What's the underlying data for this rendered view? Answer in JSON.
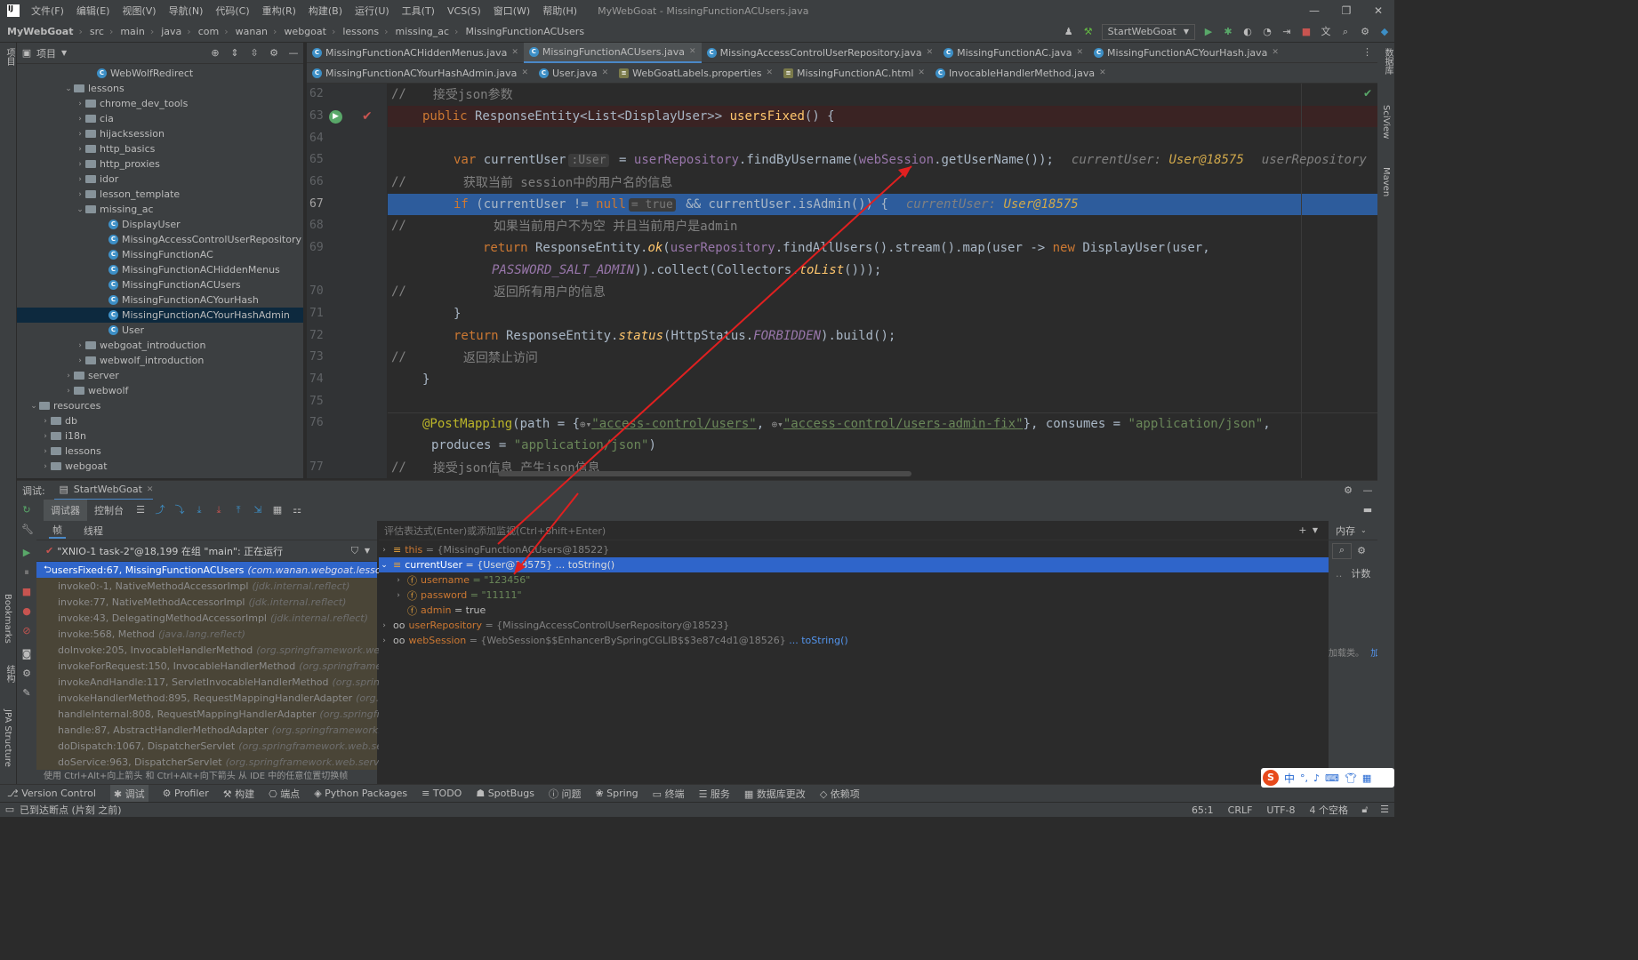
{
  "menu": [
    "文件(F)",
    "编辑(E)",
    "视图(V)",
    "导航(N)",
    "代码(C)",
    "重构(R)",
    "构建(B)",
    "运行(U)",
    "工具(T)",
    "VCS(S)",
    "窗口(W)",
    "帮助(H)"
  ],
  "window_title": "MyWebGoat - MissingFunctionACUsers.java",
  "breadcrumbs": [
    "MyWebGoat",
    "src",
    "main",
    "java",
    "com",
    "wanan",
    "webgoat",
    "lessons",
    "missing_ac",
    "MissingFunctionACUsers"
  ],
  "run_config": "StartWebGoat",
  "project_label": "项目",
  "tree": [
    {
      "label": "WebWolfRedirect",
      "type": "class",
      "depth": 6,
      "arrow": ""
    },
    {
      "label": "lessons",
      "type": "folder",
      "depth": 4,
      "arrow": "open"
    },
    {
      "label": "chrome_dev_tools",
      "type": "folder",
      "depth": 5,
      "arrow": "closed"
    },
    {
      "label": "cia",
      "type": "folder",
      "depth": 5,
      "arrow": "closed"
    },
    {
      "label": "hijacksession",
      "type": "folder",
      "depth": 5,
      "arrow": "closed"
    },
    {
      "label": "http_basics",
      "type": "folder",
      "depth": 5,
      "arrow": "closed"
    },
    {
      "label": "http_proxies",
      "type": "folder",
      "depth": 5,
      "arrow": "closed"
    },
    {
      "label": "idor",
      "type": "folder",
      "depth": 5,
      "arrow": "closed"
    },
    {
      "label": "lesson_template",
      "type": "folder",
      "depth": 5,
      "arrow": "closed"
    },
    {
      "label": "missing_ac",
      "type": "folder",
      "depth": 5,
      "arrow": "open"
    },
    {
      "label": "DisplayUser",
      "type": "class",
      "depth": 7,
      "arrow": ""
    },
    {
      "label": "MissingAccessControlUserRepository",
      "type": "class",
      "depth": 7,
      "arrow": ""
    },
    {
      "label": "MissingFunctionAC",
      "type": "class",
      "depth": 7,
      "arrow": ""
    },
    {
      "label": "MissingFunctionACHiddenMenus",
      "type": "class",
      "depth": 7,
      "arrow": ""
    },
    {
      "label": "MissingFunctionACUsers",
      "type": "class",
      "depth": 7,
      "arrow": ""
    },
    {
      "label": "MissingFunctionACYourHash",
      "type": "class",
      "depth": 7,
      "arrow": ""
    },
    {
      "label": "MissingFunctionACYourHashAdmin",
      "type": "class",
      "depth": 7,
      "arrow": "",
      "selected": true
    },
    {
      "label": "User",
      "type": "class",
      "depth": 7,
      "arrow": ""
    },
    {
      "label": "webgoat_introduction",
      "type": "folder",
      "depth": 5,
      "arrow": "closed"
    },
    {
      "label": "webwolf_introduction",
      "type": "folder",
      "depth": 5,
      "arrow": "closed"
    },
    {
      "label": "server",
      "type": "folder",
      "depth": 4,
      "arrow": "closed"
    },
    {
      "label": "webwolf",
      "type": "folder",
      "depth": 4,
      "arrow": "closed"
    },
    {
      "label": "resources",
      "type": "folder",
      "depth": 1,
      "arrow": "open"
    },
    {
      "label": "db",
      "type": "folder",
      "depth": 2,
      "arrow": "closed"
    },
    {
      "label": "i18n",
      "type": "folder",
      "depth": 2,
      "arrow": "closed"
    },
    {
      "label": "lessons",
      "type": "folder",
      "depth": 2,
      "arrow": "closed"
    },
    {
      "label": "webgoat",
      "type": "folder",
      "depth": 2,
      "arrow": "closed"
    }
  ],
  "tabs_row1": [
    {
      "label": "MissingFunctionACHiddenMenus.java",
      "active": false
    },
    {
      "label": "MissingFunctionACUsers.java",
      "active": true
    },
    {
      "label": "MissingAccessControlUserRepository.java",
      "active": false
    },
    {
      "label": "MissingFunctionAC.java",
      "active": false
    },
    {
      "label": "MissingFunctionACYourHash.java",
      "active": false
    }
  ],
  "tabs_row2": [
    {
      "label": "MissingFunctionACYourHashAdmin.java",
      "active": false
    },
    {
      "label": "User.java",
      "active": false
    },
    {
      "label": "WebGoatLabels.properties",
      "active": false
    },
    {
      "label": "MissingFunctionAC.html",
      "active": false
    },
    {
      "label": "InvocableHandlerMethod.java",
      "active": false
    }
  ],
  "line_numbers": [
    "62",
    "63",
    "64",
    "65",
    "66",
    "67",
    "68",
    "69",
    "",
    "70",
    "71",
    "72",
    "73",
    "74",
    "75",
    "76",
    "",
    "77"
  ],
  "code": {
    "l62": "接受json参数",
    "l63_kw": "public",
    "l63_type": " ResponseEntity<List<DisplayUser>> ",
    "l63_fn": "usersFixed",
    "l63_end": "() {",
    "l65_var": "var",
    "l65_name": " currentUser",
    "l65_hint": ":User",
    "l65_eq": " = ",
    "l65_repo": "userRepository",
    "l65_call": ".findByUsername(",
    "l65_sess": "webSession",
    "l65_end": ".getUserName());",
    "l65_inl_label": "currentUser: ",
    "l65_inl_val": "User@18575",
    "l65_inl2": "userRepository",
    "l66": "获取当前 session中的用户名的信息",
    "l67_if": "if",
    "l67_a": " (currentUser != ",
    "l67_null": "null",
    "l67_hint": "= true",
    "l67_b": " && currentUser.isAdmin()) {",
    "l67_inl_label": "currentUser: ",
    "l67_inl_val": "User@18575",
    "l68": "如果当前用户不为空 并且当前用户是admin",
    "l69_ret": "return",
    "l69_a": " ResponseEntity.",
    "l69_ok": "ok",
    "l69_b": "(",
    "l69_repo": "userRepository",
    "l69_c": ".findAllUsers().stream().map(user -> ",
    "l69_new": "new",
    "l69_d": " DisplayUser(user,",
    "l69b_const": "PASSWORD_SALT_ADMIN",
    "l69b_a": ")).collect(Collectors.",
    "l69b_tolist": "toList",
    "l69b_b": "()));",
    "l70": "返回所有用户的信息",
    "l71": "}",
    "l72_ret": "return",
    "l72_a": " ResponseEntity.",
    "l72_status": "status",
    "l72_b": "(HttpStatus.",
    "l72_forb": "FORBIDDEN",
    "l72_c": ").build();",
    "l73": "返回禁止访问",
    "l74": "}",
    "l76_ann": "@PostMapping",
    "l76_a": "(path = {",
    "l76_s1": "\"access-control/users\"",
    "l76_b": ", ",
    "l76_s2": "\"access-control/users-admin-fix\"",
    "l76_c": "}, consumes = ",
    "l76_s3": "\"application/json\"",
    "l76_d": ",",
    "l76b_a": "produces = ",
    "l76b_s": "\"application/json\"",
    "l76b_b": ")",
    "l77": "接受json信息 产生json信息",
    "comment_marker": "//"
  },
  "debug": {
    "label": "调试:",
    "session": "StartWebGoat",
    "tab_debugger": "调试器",
    "tab_console": "控制台",
    "tab_frames": "帧",
    "tab_threads": "线程",
    "thread": "\"XNIO-1 task-2\"@18,199 在组 \"main\": 正在运行",
    "eval_placeholder": "评估表达式(Enter)或添加监视(Ctrl+Shift+Enter)",
    "memory": "内存",
    "count": "计数",
    "loaded_hint": "加载",
    "loaded_prefix": "加载类。",
    "hint": "使用 Ctrl+Alt+向上箭头 和 Ctrl+Alt+向下箭头 从 IDE 中的任意位置切换帧"
  },
  "frames": [
    {
      "name": "usersFixed:67, MissingFunctionACUsers",
      "pkg": "(com.wanan.webgoat.lessons.mis",
      "selected": true
    },
    {
      "name": "invoke0:-1, NativeMethodAccessorImpl",
      "pkg": "(jdk.internal.reflect)"
    },
    {
      "name": "invoke:77, NativeMethodAccessorImpl",
      "pkg": "(jdk.internal.reflect)"
    },
    {
      "name": "invoke:43, DelegatingMethodAccessorImpl",
      "pkg": "(jdk.internal.reflect)"
    },
    {
      "name": "invoke:568, Method",
      "pkg": "(java.lang.reflect)"
    },
    {
      "name": "doInvoke:205, InvocableHandlerMethod",
      "pkg": "(org.springframework.web.meth"
    },
    {
      "name": "invokeForRequest:150, InvocableHandlerMethod",
      "pkg": "(org.springframework.w"
    },
    {
      "name": "invokeAndHandle:117, ServletInvocableHandlerMethod",
      "pkg": "(org.springframe"
    },
    {
      "name": "invokeHandlerMethod:895, RequestMappingHandlerAdapter",
      "pkg": "(org.spring"
    },
    {
      "name": "handleInternal:808, RequestMappingHandlerAdapter",
      "pkg": "(org.springframew"
    },
    {
      "name": "handle:87, AbstractHandlerMethodAdapter",
      "pkg": "(org.springframework.web.se"
    },
    {
      "name": "doDispatch:1067, DispatcherServlet",
      "pkg": "(org.springframework.web.servlet)"
    },
    {
      "name": "doService:963, DispatcherServlet",
      "pkg": "(org.springframework.web.servlet)"
    }
  ],
  "variables": {
    "this_name": "this",
    "this_val": "= {MissingFunctionACUsers@18522}",
    "cu_name": "currentUser",
    "cu_val": "= {User@18575}",
    "cu_tostring": "... toString()",
    "username_name": "username",
    "username_val": "= \"123456\"",
    "password_name": "password",
    "password_val": "= \"11111\"",
    "admin_name": "admin",
    "admin_val": "= true",
    "repo_name": "userRepository",
    "repo_val": "= {MissingAccessControlUserRepository@18523}",
    "ws_name": "webSession",
    "ws_val": "= {WebSession$$EnhancerBySpringCGLIB$$3e87c4d1@18526}",
    "ws_tostring": "... toString()"
  },
  "bottom_tools": [
    "Version Control",
    "调试",
    "Profiler",
    "构建",
    "端点",
    "Python Packages",
    "TODO",
    "SpotBugs",
    "问题",
    "Spring",
    "终端",
    "服务",
    "数据库更改",
    "依赖项"
  ],
  "status": {
    "message": "已到达断点 (片刻 之前)",
    "position": "65:1",
    "line_sep": "CRLF",
    "encoding": "UTF-8",
    "indent": "4 个空格"
  },
  "left_strip_labels": [
    "项目",
    "Bookmarks",
    "结构",
    "JPA Structure"
  ],
  "right_strip_labels": [
    "数据库",
    "SciView",
    "Maven"
  ],
  "ime": "中"
}
